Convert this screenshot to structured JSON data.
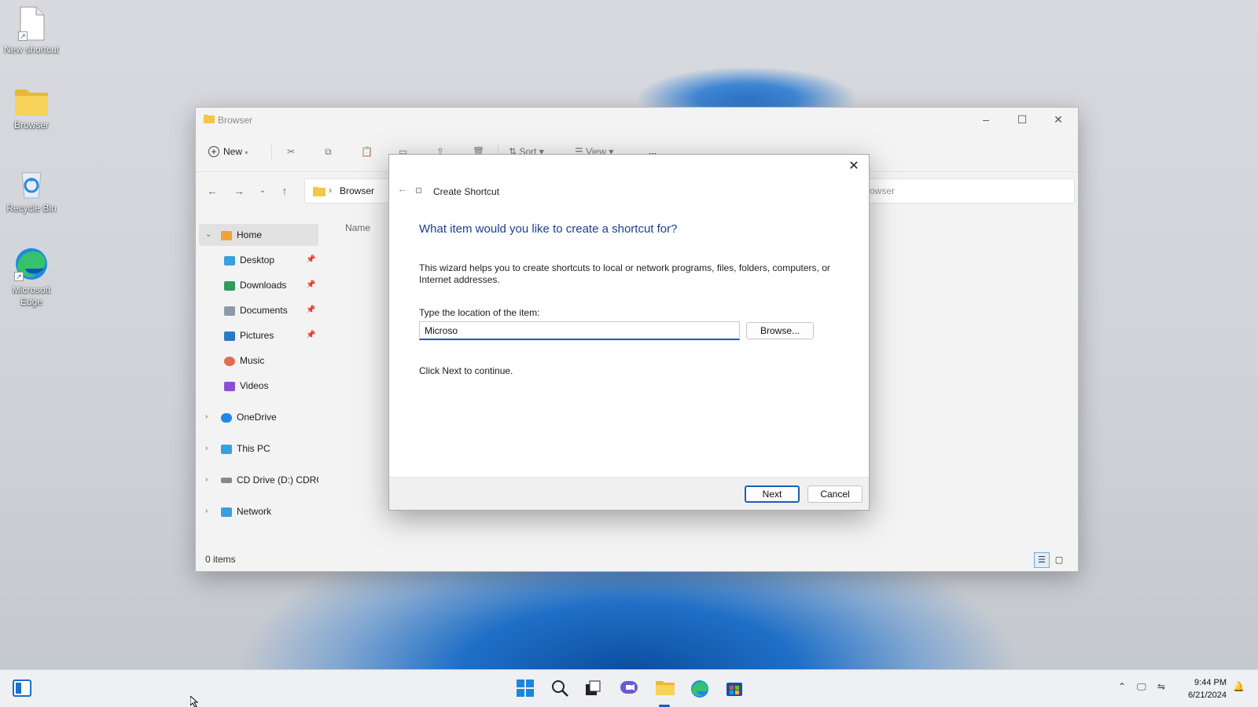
{
  "desktop": {
    "icons": [
      {
        "label": "New shortcut",
        "icon": "blank-file-shortcut-icon"
      },
      {
        "label": "Browser",
        "icon": "folder-icon"
      },
      {
        "label": "Recycle Bin",
        "icon": "recycle-bin-icon"
      },
      {
        "label": "Microsoft Edge",
        "icon": "edge-icon"
      }
    ]
  },
  "explorer": {
    "title": "Browser",
    "toolbar": {
      "new_label": "New",
      "sort_label": "Sort",
      "view_label": "View",
      "more_label": "..."
    },
    "address": {
      "crumb": "Browser",
      "search_fragment": "owser"
    },
    "column_header": "Name",
    "nav": {
      "home": "Home",
      "desktop": "Desktop",
      "downloads": "Downloads",
      "documents": "Documents",
      "pictures": "Pictures",
      "music": "Music",
      "videos": "Videos",
      "onedrive": "OneDrive",
      "thispc": "This PC",
      "cddrive": "CD Drive (D:) CDROI",
      "network": "Network"
    },
    "status": "0 items"
  },
  "dialog": {
    "title": "Create Shortcut",
    "heading": "What item would you like to create a shortcut for?",
    "description": "This wizard helps you to create shortcuts to local or network programs, files, folders, computers, or Internet addresses.",
    "location_label": "Type the location of the item:",
    "location_value": "Microso",
    "browse_label": "Browse...",
    "hint": "Click Next to continue.",
    "next_label": "Next",
    "cancel_label": "Cancel"
  },
  "taskbar": {
    "time": "9:44 PM",
    "date": "6/21/2024"
  },
  "colors": {
    "accent": "#1a5fb4",
    "heading_blue": "#1b3f8f",
    "folder_yellow": "#f2c744"
  }
}
